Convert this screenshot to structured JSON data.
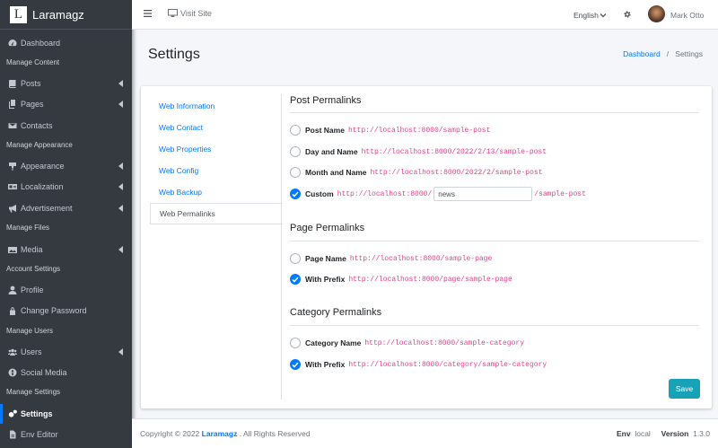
{
  "brand": {
    "logo_letter": "L",
    "name": "Laramagz"
  },
  "sidebar": {
    "dashboard": "Dashboard",
    "h_content": "Manage Content",
    "posts": "Posts",
    "pages": "Pages",
    "contacts": "Contacts",
    "h_appearance": "Manage Appearance",
    "appearance": "Appearance",
    "localization": "Localization",
    "advertisement": "Advertisement",
    "h_files": "Manage Files",
    "media": "Media",
    "h_account": "Account Settings",
    "profile": "Profile",
    "change_password": "Change Password",
    "h_users": "Manage Users",
    "users": "Users",
    "social_media": "Social Media",
    "h_settings": "Manage Settings",
    "settings": "Settings",
    "env_editor": "Env Editor"
  },
  "topbar": {
    "visit_site": "Visit Site",
    "language": "English",
    "user_name": "Mark Otto"
  },
  "page": {
    "title": "Settings",
    "breadcrumb_home": "Dashboard",
    "breadcrumb_sep": "/",
    "breadcrumb_current": "Settings"
  },
  "tabs": [
    "Web Information",
    "Web Contact",
    "Web Properties",
    "Web Config",
    "Web Backup",
    "Web Permalinks"
  ],
  "post_permalinks": {
    "title": "Post Permalinks",
    "options": [
      {
        "label": "Post Name",
        "url": "http://localhost:8000/sample-post",
        "checked": false
      },
      {
        "label": "Day and Name",
        "url": "http://localhost:8000/2022/2/13/sample-post",
        "checked": false
      },
      {
        "label": "Month and Name",
        "url": "http://localhost:8000/2022/2/sample-post",
        "checked": false
      }
    ],
    "custom": {
      "label": "Custom",
      "prefix": "http://localhost:8000/",
      "value": "news",
      "suffix": "/sample-post",
      "checked": true
    }
  },
  "page_permalinks": {
    "title": "Page Permalinks",
    "options": [
      {
        "label": "Page Name",
        "url": "http://localhost:8000/sample-page",
        "checked": false
      },
      {
        "label": "With Prefix",
        "url": "http://localhost:8000/page/sample-page",
        "checked": true
      }
    ]
  },
  "category_permalinks": {
    "title": "Category Permalinks",
    "options": [
      {
        "label": "Category Name",
        "url": "http://localhost:8000/sample-category",
        "checked": false
      },
      {
        "label": "With Prefix",
        "url": "http://localhost:8000/category/sample-category",
        "checked": true
      }
    ]
  },
  "save_label": "Save",
  "footer": {
    "copyright": "Copyright © 2022",
    "brand": "Laramagz",
    "rights": ". All Rights Reserved",
    "env_label": "Env",
    "env_value": "local",
    "version_label": "Version",
    "version_value": "1.3.0"
  },
  "colors": {
    "sidebar": "#343a40",
    "accent": "#007bff",
    "save": "#17a2b8",
    "url": "#e83e8c"
  }
}
